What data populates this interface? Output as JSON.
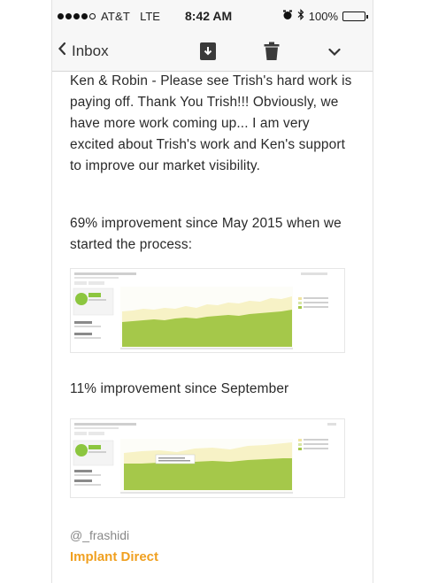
{
  "status_bar": {
    "carrier": "AT&T",
    "network": "LTE",
    "time": "8:42 AM",
    "battery": "100%",
    "signal_dots_filled": 4,
    "signal_dots_total": 5,
    "icons": [
      "alarm-icon",
      "bluetooth-icon",
      "battery-icon"
    ]
  },
  "nav_bar": {
    "back_label": "Inbox",
    "icons": [
      "back-chevron-icon",
      "archive-icon",
      "trash-icon",
      "chevron-down-icon"
    ]
  },
  "email": {
    "body_paragraphs": [
      "Ken & Robin - Please see Trish's hard work is paying off. Thank You Trish!!! Obviously, we have more work coming up... I am very excited about Trish's work and Ken's support to improve our market visibility.",
      "69% improvement since May 2015 when we started the process:",
      "11% improvement since September"
    ],
    "signature_handle": "@_frashidi",
    "signature_company": "Implant Direct"
  },
  "colors": {
    "accent": "#f0a020",
    "chart_green": "#a5c84a",
    "chart_cream": "#f7f2c6",
    "chart_light_green": "#d7e6a5"
  }
}
